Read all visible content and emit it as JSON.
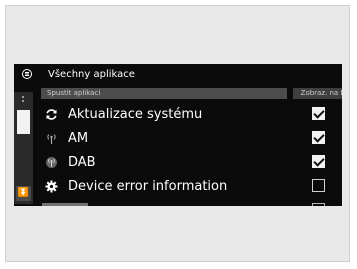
{
  "header": {
    "title": "Všechny aplikace",
    "menu_icon": "menu-list-icon"
  },
  "columns": {
    "left": "Spustit aplikaci",
    "right": "Zobraz. na DO"
  },
  "items": [
    {
      "label": "Aktualizace systému",
      "icon": "refresh-icon",
      "checked": true
    },
    {
      "label": "AM",
      "icon": "radio-antenna-icon",
      "checked": true
    },
    {
      "label": "DAB",
      "icon": "dab-radio-icon",
      "checked": true
    },
    {
      "label": "Device error information",
      "icon": "gear-icon",
      "checked": false
    }
  ],
  "colors": {
    "screen_bg": "#0b0b0b",
    "text": "#ffffff",
    "subheader_bg": "#4d4d4d"
  }
}
